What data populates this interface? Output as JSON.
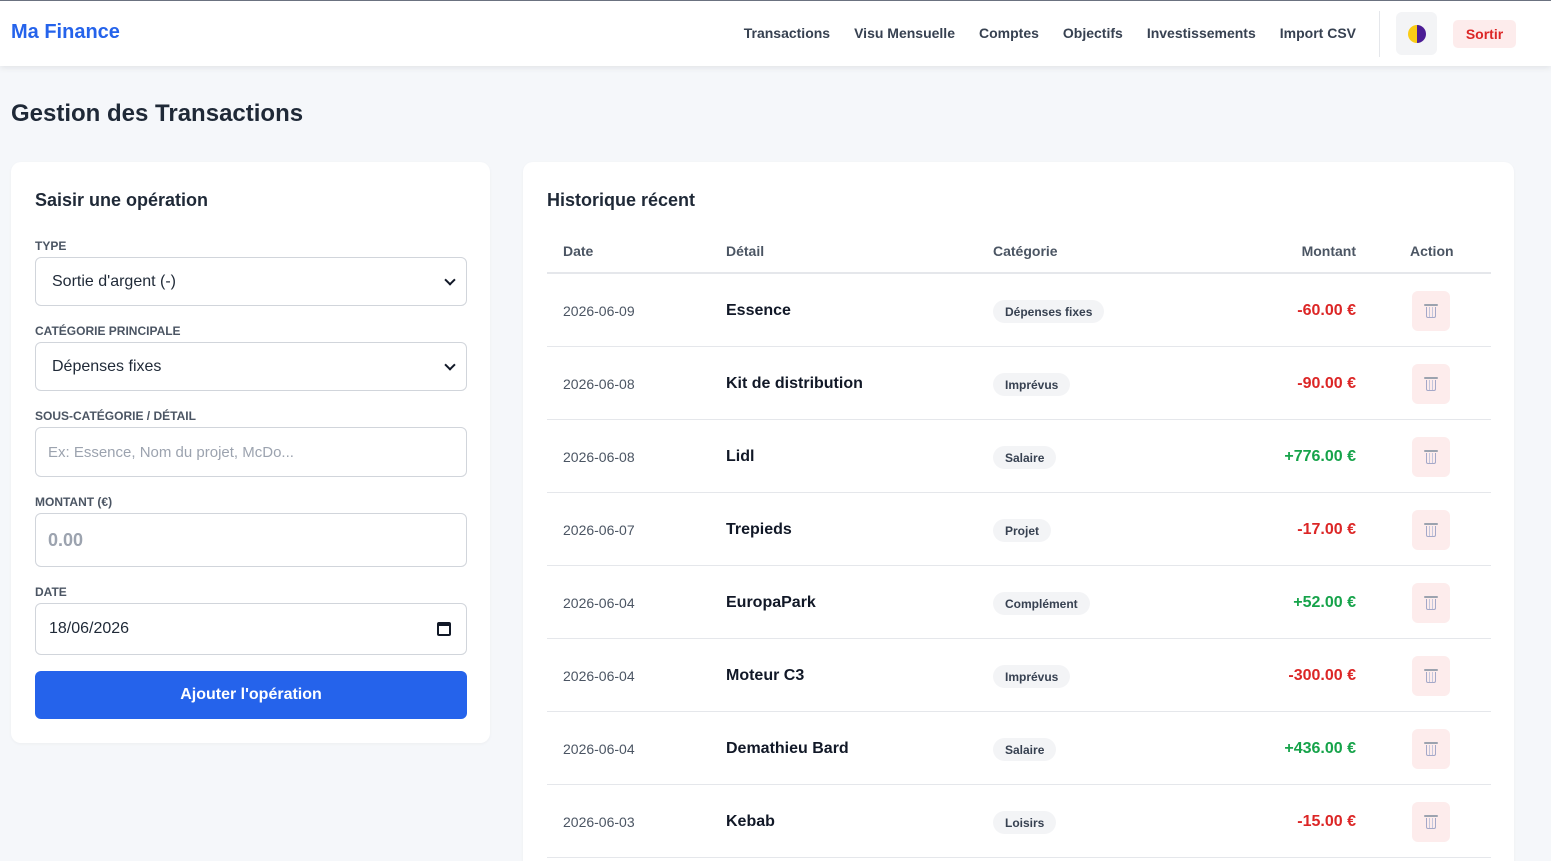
{
  "app": {
    "brand": "Ma Finance"
  },
  "nav": {
    "items": [
      "Transactions",
      "Visu Mensuelle",
      "Comptes",
      "Objectifs",
      "Investissements",
      "Import CSV"
    ],
    "logout": "Sortir",
    "theme_icon": "theme-toggle-icon"
  },
  "page": {
    "title": "Gestion des Transactions"
  },
  "form": {
    "title": "Saisir une opération",
    "type_label": "TYPE",
    "type_value": "Sortie d'argent (-)",
    "category_label": "CATÉGORIE PRINCIPALE",
    "category_value": "Dépenses fixes",
    "subcategory_label": "SOUS-CATÉGORIE / DÉTAIL",
    "subcategory_placeholder": "Ex: Essence, Nom du projet, McDo...",
    "amount_label": "MONTANT (€)",
    "amount_placeholder": "0.00",
    "date_label": "DATE",
    "date_value": "18/06/2026",
    "submit": "Ajouter l'opération"
  },
  "history": {
    "title": "Historique récent",
    "columns": {
      "date": "Date",
      "detail": "Détail",
      "category": "Catégorie",
      "amount": "Montant",
      "action": "Action"
    },
    "rows": [
      {
        "date": "2026-06-09",
        "detail": "Essence",
        "category": "Dépenses fixes",
        "amount": "-60.00 €",
        "sign": "neg"
      },
      {
        "date": "2026-06-08",
        "detail": "Kit de distribution",
        "category": "Imprévus",
        "amount": "-90.00 €",
        "sign": "neg"
      },
      {
        "date": "2026-06-08",
        "detail": "Lidl",
        "category": "Salaire",
        "amount": "+776.00 €",
        "sign": "pos"
      },
      {
        "date": "2026-06-07",
        "detail": "Trepieds",
        "category": "Projet",
        "amount": "-17.00 €",
        "sign": "neg"
      },
      {
        "date": "2026-06-04",
        "detail": "EuropaPark",
        "category": "Complément",
        "amount": "+52.00 €",
        "sign": "pos"
      },
      {
        "date": "2026-06-04",
        "detail": "Moteur C3",
        "category": "Imprévus",
        "amount": "-300.00 €",
        "sign": "neg"
      },
      {
        "date": "2026-06-04",
        "detail": "Demathieu Bard",
        "category": "Salaire",
        "amount": "+436.00 €",
        "sign": "pos"
      },
      {
        "date": "2026-06-03",
        "detail": "Kebab",
        "category": "Loisirs",
        "amount": "-15.00 €",
        "sign": "neg"
      }
    ]
  },
  "colors": {
    "accent": "#2563eb",
    "negative": "#dc2626",
    "positive": "#16a34a"
  }
}
